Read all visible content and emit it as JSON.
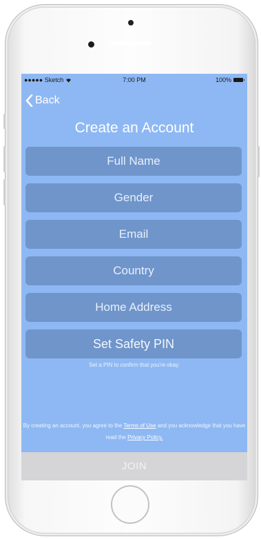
{
  "status_bar": {
    "carrier": "●●●●● Sketch",
    "time": "7:00 PM",
    "battery": "100%"
  },
  "nav": {
    "back_label": "Back"
  },
  "title": "Create an Account",
  "fields": {
    "full_name": "Full Name",
    "gender": "Gender",
    "email": "Email",
    "country": "Country",
    "home_address": "Home Address",
    "safety_pin": "Set Safety PIN"
  },
  "pin_hint": "Set a PIN to confirm that you're okay.",
  "legal": {
    "prefix": "By creating an account, you agree to the",
    "terms_link": "Terms of Use",
    "middle": "and you acknowledge that you have read the",
    "privacy_link": "Privacy Policy."
  },
  "join_label": "JOIN",
  "colors": {
    "screen_bg": "#8eb8f3",
    "field_bg": "#6f95cb",
    "join_bg": "#d5d5d7"
  },
  "icons": [
    "wifi-icon",
    "battery-icon",
    "chevron-left-icon"
  ]
}
